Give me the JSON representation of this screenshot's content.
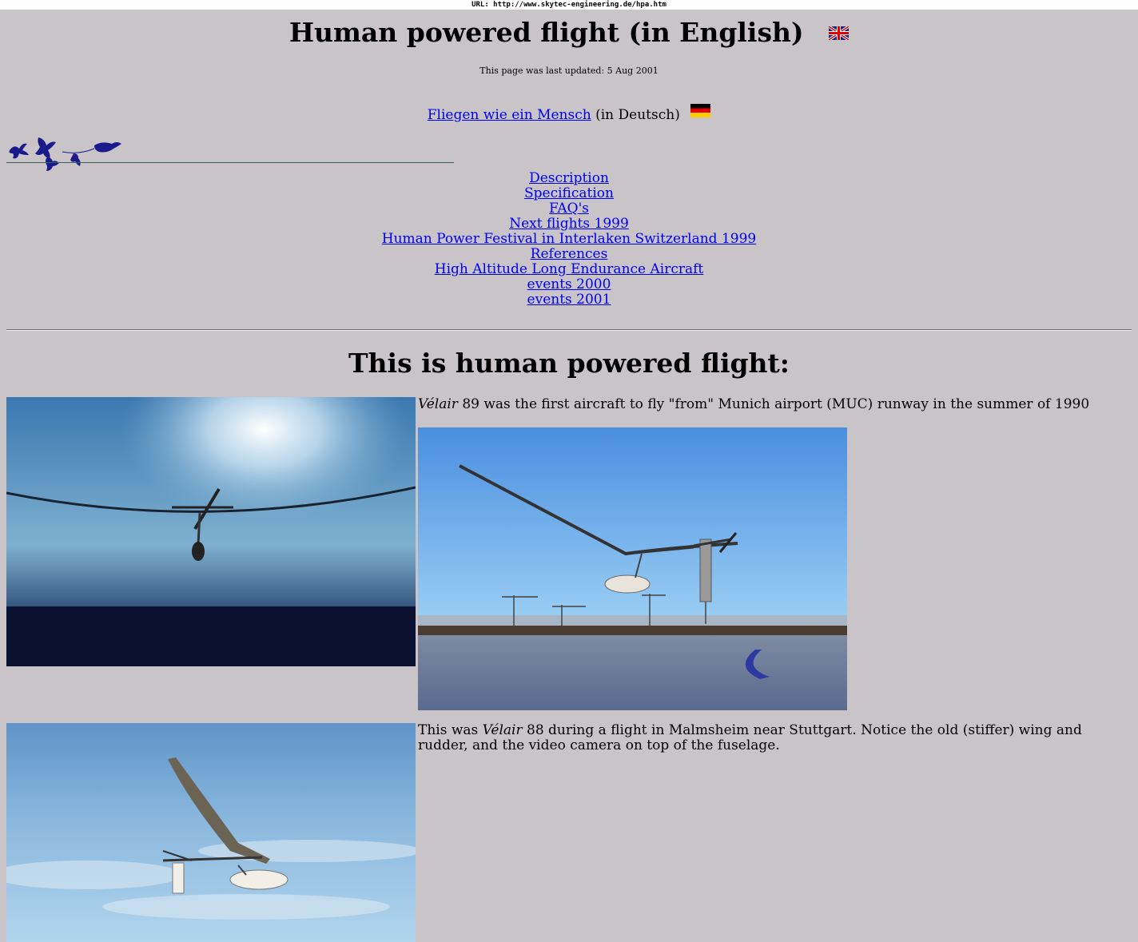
{
  "url_bar": "URL: http://www.skytec-engineering.de/hpa.htm",
  "header": {
    "title": "Human powered flight (in English)",
    "last_updated": "This page was last updated: 5 Aug 2001",
    "german_link": "Fliegen wie ein Mensch",
    "german_suffix": "(in Deutsch)"
  },
  "nav": {
    "items": [
      "Description",
      "Specification",
      "FAQ's",
      "Next flights 1999",
      "Human Power Festival in Interlaken Switzerland 1999",
      "References",
      "High Altitude Long Endurance Aircraft",
      "events 2000",
      "events 2001"
    ]
  },
  "main": {
    "heading": "This is human powered flight:",
    "caption1_italic": "Vélair",
    "caption1_rest": " 89 was the first aircraft to fly \"from\" Munich airport (MUC) runway in the summer of 1990",
    "caption2_pre": "This was ",
    "caption2_italic": "Vélair",
    "caption2_rest": " 88 during a flight in Malmsheim near Stuttgart. Notice the old (stiffer) wing and rudder, and the video camera on top of the fuselage."
  },
  "colors": {
    "background": "#c8c4c8",
    "link": "#0000ee"
  }
}
